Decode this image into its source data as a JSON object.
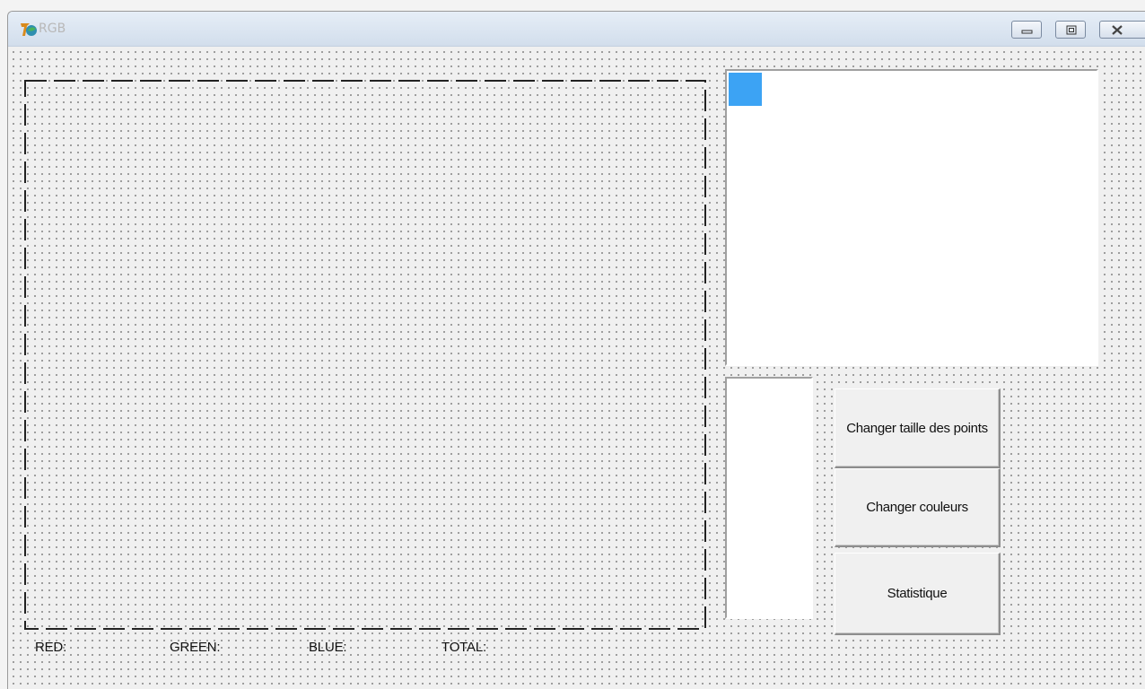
{
  "window": {
    "title": "RGB",
    "controls": [
      "minimize-icon",
      "maximize-icon",
      "close-icon"
    ]
  },
  "color_preview": {
    "swatch_color": "#3ca3f4",
    "background": "#ffffff"
  },
  "buttons": {
    "change_point_size": "Changer taille des points",
    "change_colors": "Changer couleurs",
    "statistics": "Statistique"
  },
  "stats": {
    "red_label": "RED:",
    "green_label": "GREEN:",
    "blue_label": "BLUE:",
    "total_label": "TOTAL:"
  }
}
